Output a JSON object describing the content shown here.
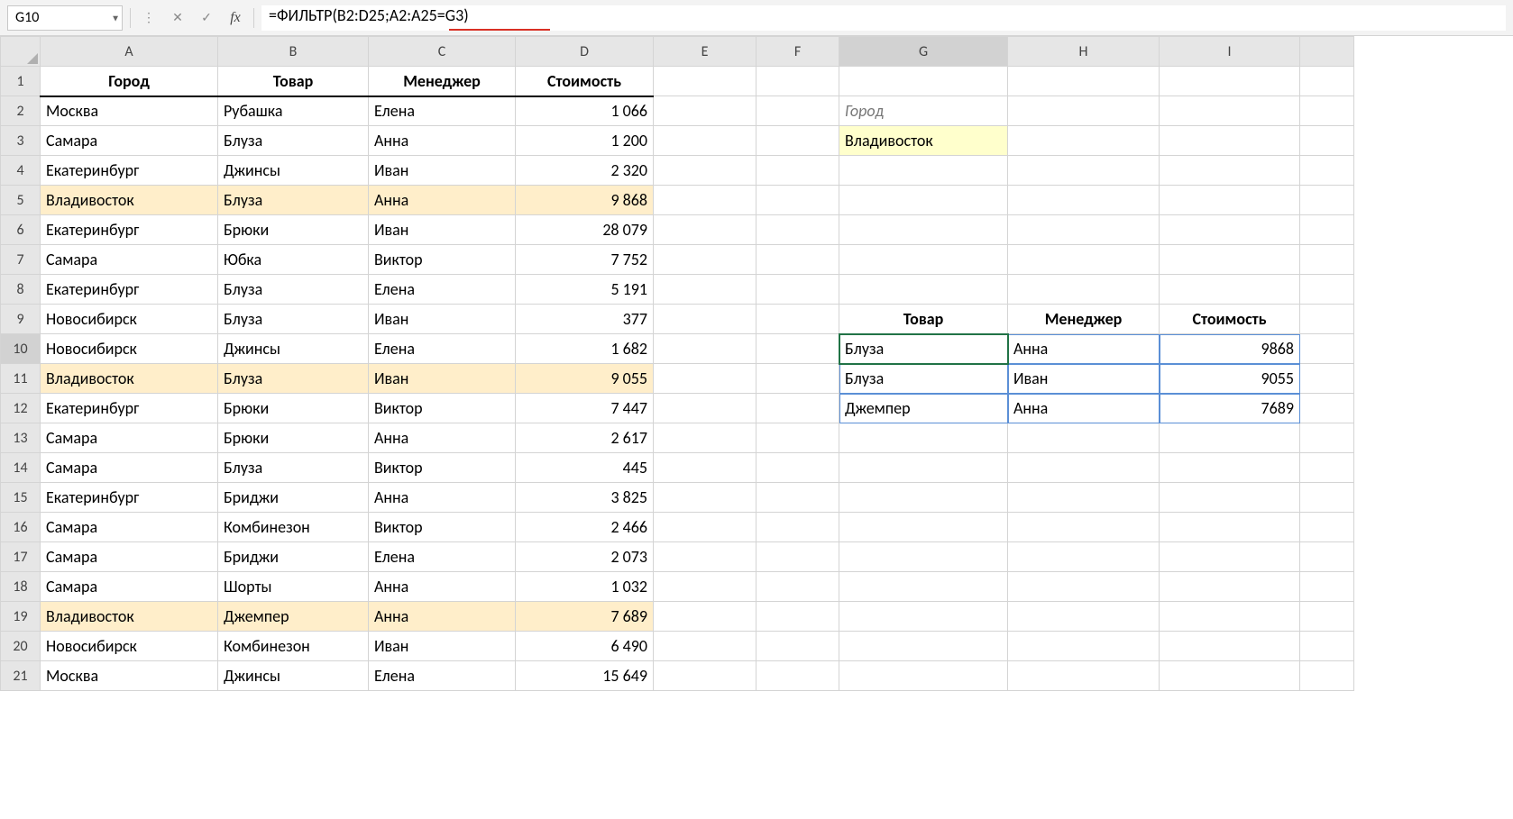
{
  "nameBox": "G10",
  "formula": "=ФИЛЬТР(B2:D25;A2:A25=G3)",
  "underline": {
    "text": "A2:A25=G3"
  },
  "columns": [
    "A",
    "B",
    "C",
    "D",
    "E",
    "F",
    "G",
    "H",
    "I"
  ],
  "selectedCol": "G",
  "selectedRow": "10",
  "headers1": {
    "A": "Город",
    "B": "Товар",
    "C": "Менеджер",
    "D": "Стоимость"
  },
  "rows": [
    {
      "r": "2",
      "A": "Москва",
      "B": "Рубашка",
      "C": "Елена",
      "D": "1 066"
    },
    {
      "r": "3",
      "A": "Самара",
      "B": "Блуза",
      "C": "Анна",
      "D": "1 200"
    },
    {
      "r": "4",
      "A": "Екатеринбург",
      "B": "Джинсы",
      "C": "Иван",
      "D": "2 320"
    },
    {
      "r": "5",
      "A": "Владивосток",
      "B": "Блуза",
      "C": "Анна",
      "D": "9 868",
      "hl": true
    },
    {
      "r": "6",
      "A": "Екатеринбург",
      "B": "Брюки",
      "C": "Иван",
      "D": "28 079"
    },
    {
      "r": "7",
      "A": "Самара",
      "B": "Юбка",
      "C": "Виктор",
      "D": "7 752"
    },
    {
      "r": "8",
      "A": "Екатеринбург",
      "B": "Блуза",
      "C": "Елена",
      "D": "5 191"
    },
    {
      "r": "9",
      "A": "Новосибирск",
      "B": "Блуза",
      "C": "Иван",
      "D": "377"
    },
    {
      "r": "10",
      "A": "Новосибирск",
      "B": "Джинсы",
      "C": "Елена",
      "D": "1 682"
    },
    {
      "r": "11",
      "A": "Владивосток",
      "B": "Блуза",
      "C": "Иван",
      "D": "9 055",
      "hl": true
    },
    {
      "r": "12",
      "A": "Екатеринбург",
      "B": "Брюки",
      "C": "Виктор",
      "D": "7 447"
    },
    {
      "r": "13",
      "A": "Самара",
      "B": "Брюки",
      "C": "Анна",
      "D": "2 617"
    },
    {
      "r": "14",
      "A": "Самара",
      "B": "Блуза",
      "C": "Виктор",
      "D": "445"
    },
    {
      "r": "15",
      "A": "Екатеринбург",
      "B": "Бриджи",
      "C": "Анна",
      "D": "3 825"
    },
    {
      "r": "16",
      "A": "Самара",
      "B": "Комбинезон",
      "C": "Виктор",
      "D": "2 466"
    },
    {
      "r": "17",
      "A": "Самара",
      "B": "Бриджи",
      "C": "Елена",
      "D": "2 073"
    },
    {
      "r": "18",
      "A": "Самара",
      "B": "Шорты",
      "C": "Анна",
      "D": "1 032"
    },
    {
      "r": "19",
      "A": "Владивосток",
      "B": "Джемпер",
      "C": "Анна",
      "D": "7 689",
      "hl": true
    },
    {
      "r": "20",
      "A": "Новосибирск",
      "B": "Комбинезон",
      "C": "Иван",
      "D": "6 490"
    },
    {
      "r": "21",
      "A": "Москва",
      "B": "Джинсы",
      "C": "Елена",
      "D": "15 649"
    }
  ],
  "g2": "Город",
  "g3": "Владивосток",
  "headers2": {
    "G": "Товар",
    "H": "Менеджер",
    "I": "Стоимость"
  },
  "filterResult": [
    {
      "G": "Блуза",
      "H": "Анна",
      "I": "9868"
    },
    {
      "G": "Блуза",
      "H": "Иван",
      "I": "9055"
    },
    {
      "G": "Джемпер",
      "H": "Анна",
      "I": "7689"
    }
  ]
}
